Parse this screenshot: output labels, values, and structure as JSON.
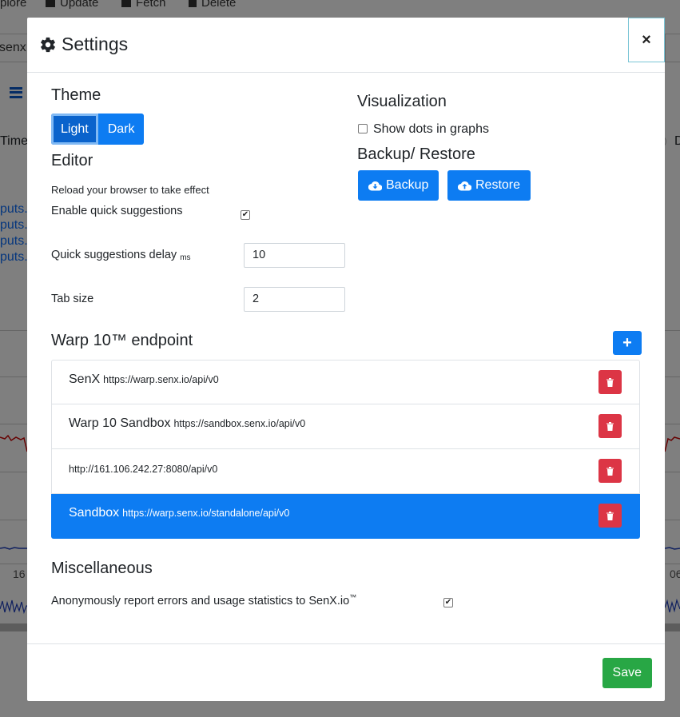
{
  "background": {
    "toolbar": [
      "plore",
      "Update",
      "Fetch",
      "Delete"
    ],
    "url_fragment": "senx.i",
    "time_label": "Time",
    "d_label": "D",
    "links": [
      "puts.",
      "puts.",
      "puts.",
      "puts."
    ],
    "axis_left": "16",
    "axis_right": "06"
  },
  "modal": {
    "title": "Settings",
    "close_label": "×",
    "theme": {
      "heading": "Theme",
      "options": [
        "Light",
        "Dark"
      ],
      "selected": "Light"
    },
    "editor": {
      "heading": "Editor",
      "note": "Reload your browser to take effect",
      "quick_suggestions_label": "Enable quick suggestions",
      "quick_suggestions_checked": true,
      "delay_label": "Quick suggestions delay",
      "delay_unit": "ms",
      "delay_value": "10",
      "tab_size_label": "Tab size",
      "tab_size_value": "2"
    },
    "visualization": {
      "heading": "Visualization",
      "show_dots_label": "Show dots in graphs",
      "show_dots_checked": false
    },
    "backup": {
      "heading": "Backup/ Restore",
      "backup_label": "Backup",
      "restore_label": "Restore"
    },
    "endpoints": {
      "heading": "Warp 10™ endpoint",
      "add_label": "+",
      "items": [
        {
          "name": "SenX",
          "url": "https://warp.senx.io/api/v0",
          "active": false
        },
        {
          "name": "Warp 10 Sandbox",
          "url": "https://sandbox.senx.io/api/v0",
          "active": false
        },
        {
          "name": "",
          "url": "http://161.106.242.27:8080/api/v0",
          "active": false
        },
        {
          "name": "Sandbox",
          "url": "https://warp.senx.io/standalone/api/v0",
          "active": true
        }
      ]
    },
    "misc": {
      "heading": "Miscellaneous",
      "report_label": "Anonymously report errors and usage statistics to SenX.io",
      "report_tm": "™",
      "report_checked": true
    },
    "save_label": "Save"
  },
  "colors": {
    "primary": "#0d7cf2",
    "danger": "#dc3545",
    "success": "#28a745"
  }
}
